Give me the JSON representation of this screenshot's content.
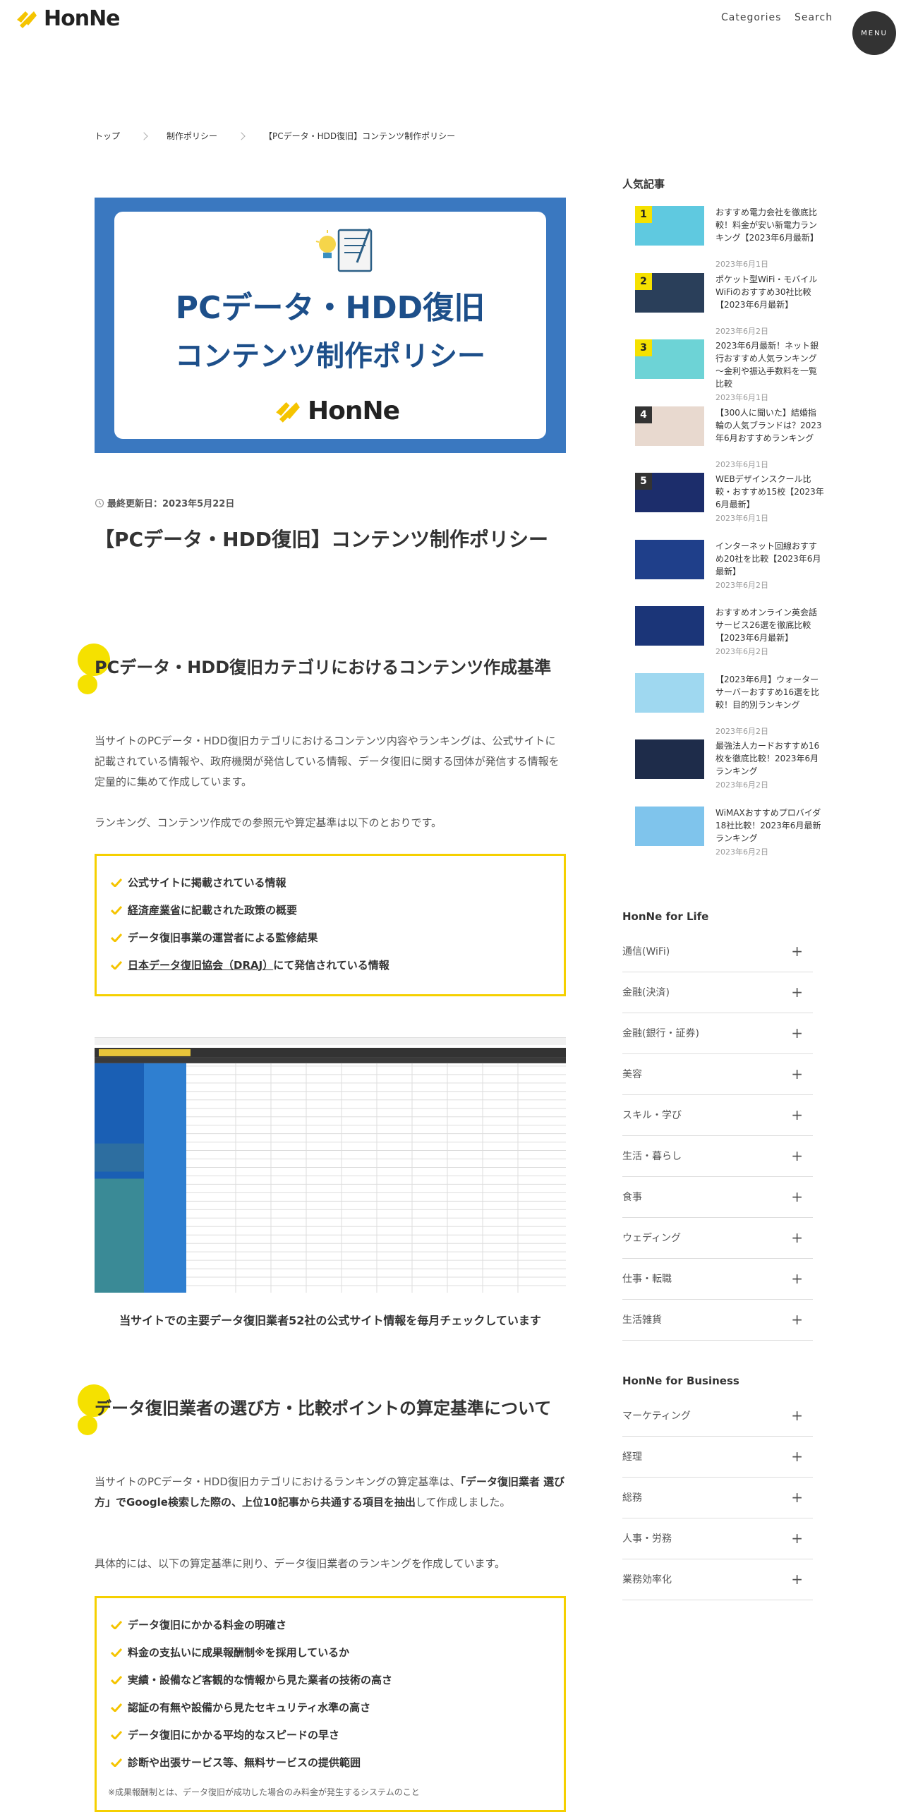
{
  "header": {
    "logo_text": "HonNe",
    "nav_categories": "Categories",
    "nav_search": "Search",
    "menu": "MENU"
  },
  "breadcrumb": {
    "items": [
      "トップ",
      "制作ポリシー",
      "【PCデータ・HDD復旧】コンテンツ制作ポリシー"
    ]
  },
  "hero": {
    "line1": "PCデータ・HDD復旧",
    "line2": "コンテンツ制作ポリシー",
    "logo_text": "HonNe"
  },
  "article": {
    "updated": "最終更新日：2023年5月22日",
    "title": "【PCデータ・HDD復旧】コンテンツ制作ポリシー",
    "section1": {
      "heading": "PCデータ・HDD復旧カテゴリにおけるコンテンツ作成基準",
      "para1": "当サイトのPCデータ・HDD復旧カテゴリにおけるコンテンツ内容やランキングは、公式サイトに記載されている情報や、政府機関が発信している情報、データ復旧に関する団体が発信する情報を定量的に集めて作成しています。",
      "para2": "ランキング、コンテンツ作成での参照元や算定基準は以下のとおりです。",
      "checks": [
        {
          "pre": "",
          "link": "",
          "text": "公式サイトに掲載されている情報"
        },
        {
          "pre": "",
          "link": "経済産業省",
          "text": "に記載された政策の概要"
        },
        {
          "pre": "",
          "link": "",
          "text": "データ復旧事業の運営者による監修結果"
        },
        {
          "pre": "",
          "link": "日本データ復旧協会（DRAJ）",
          "text": "にて発信されている情報"
        }
      ],
      "caption": "当サイトでの主要データ復旧業者52社の公式サイト情報を毎月チェックしています"
    },
    "section2": {
      "heading": "データ復旧業者の選び方・比較ポイントの算定基準について",
      "para1_a": "当サイトのPCデータ・HDD復旧カテゴリにおけるランキングの算定基準は、",
      "para1_b": "「データ復旧業者 選び方」でGoogle検索した際の、上位10記事から共通する項目を抽出",
      "para1_c": "して作成しました。",
      "para2": "具体的には、以下の算定基準に則り、データ復旧業者のランキングを作成しています。",
      "checks": [
        "データ復旧にかかる料金の明確さ",
        "料金の支払いに成果報酬制※を採用しているか",
        "実績・設備など客観的な情報から見た業者の技術の高さ",
        "認証の有無や設備から見たセキュリティ水準の高さ",
        "データ復旧にかかる平均的なスピードの早さ",
        "診断や出張サービス等、無料サービスの提供範囲"
      ],
      "note": "※成果報酬制とは、データ復旧が成功した場合のみ料金が発生するシステムのこと"
    }
  },
  "sidebar": {
    "popular_heading": "人気記事",
    "popular": [
      {
        "rank": "1",
        "title": "おすすめ電力会社を徹底比較！料金が安い新電力ランキング【2023年6月最新】",
        "date": "2023年6月1日",
        "thumb_color": "#5fc9e0"
      },
      {
        "rank": "2",
        "title": "ポケット型WiFi・モバイルWiFiのおすすめ30社比較【2023年6月最新】",
        "date": "2023年6月2日",
        "thumb_color": "#2a3f5a"
      },
      {
        "rank": "3",
        "title": "2023年6月最新！ネット銀行おすすめ人気ランキング～金利や振込手数料を一覧比較",
        "date": "2023年6月1日",
        "thumb_color": "#6dd3d6"
      },
      {
        "rank": "4",
        "title": "【300人に聞いた】結婚指輪の人気ブランドは？2023年6月おすすめランキング",
        "date": "2023年6月1日",
        "thumb_color": "#e8d9cf"
      },
      {
        "rank": "5",
        "title": "WEBデザインスクール比較・おすすめ15校【2023年6月最新】",
        "date": "2023年6月1日",
        "thumb_color": "#1c2d6b"
      },
      {
        "rank": "",
        "title": "インターネット回線おすすめ20社を比較【2023年6月最新】",
        "date": "2023年6月2日",
        "thumb_color": "#1f3f8a"
      },
      {
        "rank": "",
        "title": "おすすめオンライン英会話サービス26選を徹底比較【2023年6月最新】",
        "date": "2023年6月2日",
        "thumb_color": "#1b3578"
      },
      {
        "rank": "",
        "title": "【2023年6月】ウォーターサーバーおすすめ16選を比較！目的別ランキング",
        "date": "2023年6月2日",
        "thumb_color": "#9fd8f0"
      },
      {
        "rank": "",
        "title": "最強法人カードおすすめ16枚を徹底比較！2023年6月ランキング",
        "date": "2023年6月2日",
        "thumb_color": "#1e2c4a"
      },
      {
        "rank": "",
        "title": "WiMAXおすすめプロバイダ18社比較！2023年6月最新ランキング",
        "date": "2023年6月2日",
        "thumb_color": "#7fc4ec"
      }
    ],
    "life_heading": "HonNe for Life",
    "life": [
      "通信(WiFi)",
      "金融(決済)",
      "金融(銀行・証券)",
      "美容",
      "スキル・学び",
      "生活・暮らし",
      "食事",
      "ウェディング",
      "仕事・転職",
      "生活雑貨"
    ],
    "business_heading": "HonNe for Business",
    "business": [
      "マーケティング",
      "経理",
      "総務",
      "人事・労務",
      "業務効率化"
    ]
  },
  "colors": {
    "accent_yellow": "#f5e100",
    "hero_blue": "#3a78c0",
    "hero_text": "#1d4f8a"
  }
}
